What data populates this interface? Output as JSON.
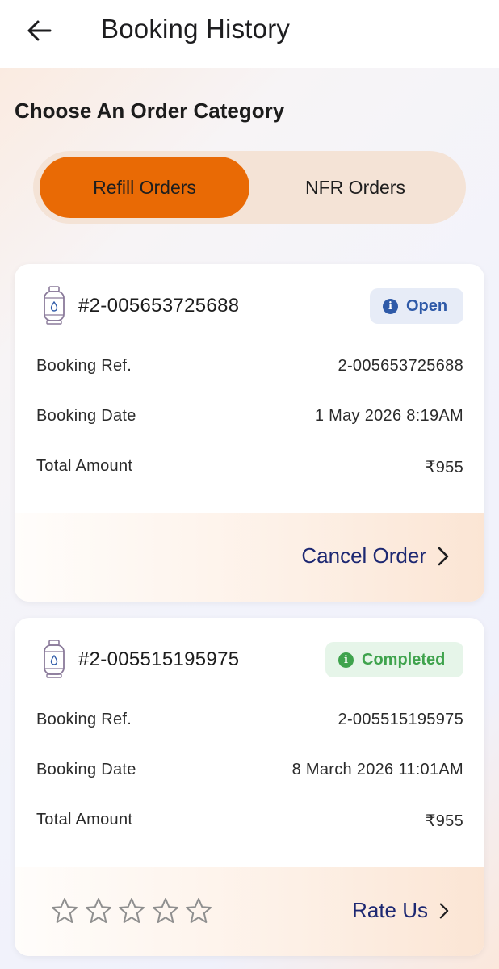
{
  "header": {
    "title": "Booking History",
    "back_icon": "arrow-left-icon"
  },
  "category": {
    "title": "Choose An Order Category",
    "tabs": [
      {
        "label": "Refill Orders",
        "selected": true
      },
      {
        "label": "NFR Orders",
        "selected": false
      }
    ]
  },
  "colors": {
    "accent": "#e96a05",
    "segment_bg": "#f4e3d6",
    "action_text": "#1d2872",
    "open_badge": "#2f5aa8",
    "completed_badge": "#3fa34d"
  },
  "orders": [
    {
      "id": "#2-005653725688",
      "status": "Open",
      "booking_ref_label": "Booking Ref.",
      "booking_ref": "2-005653725688",
      "booking_date_label": "Booking Date",
      "booking_date": "1 May 2026 8:19AM",
      "total_amount_label": "Total Amount",
      "total_amount": "₹955",
      "action_label": "Cancel Order"
    },
    {
      "id": "#2-005515195975",
      "status": "Completed",
      "booking_ref_label": "Booking Ref.",
      "booking_ref": "2-005515195975",
      "booking_date_label": "Booking Date",
      "booking_date": "8 March 2026 11:01AM",
      "total_amount_label": "Total Amount",
      "total_amount": "₹955",
      "action_label": "Rate Us",
      "rating": 0,
      "rating_max": 5
    }
  ]
}
